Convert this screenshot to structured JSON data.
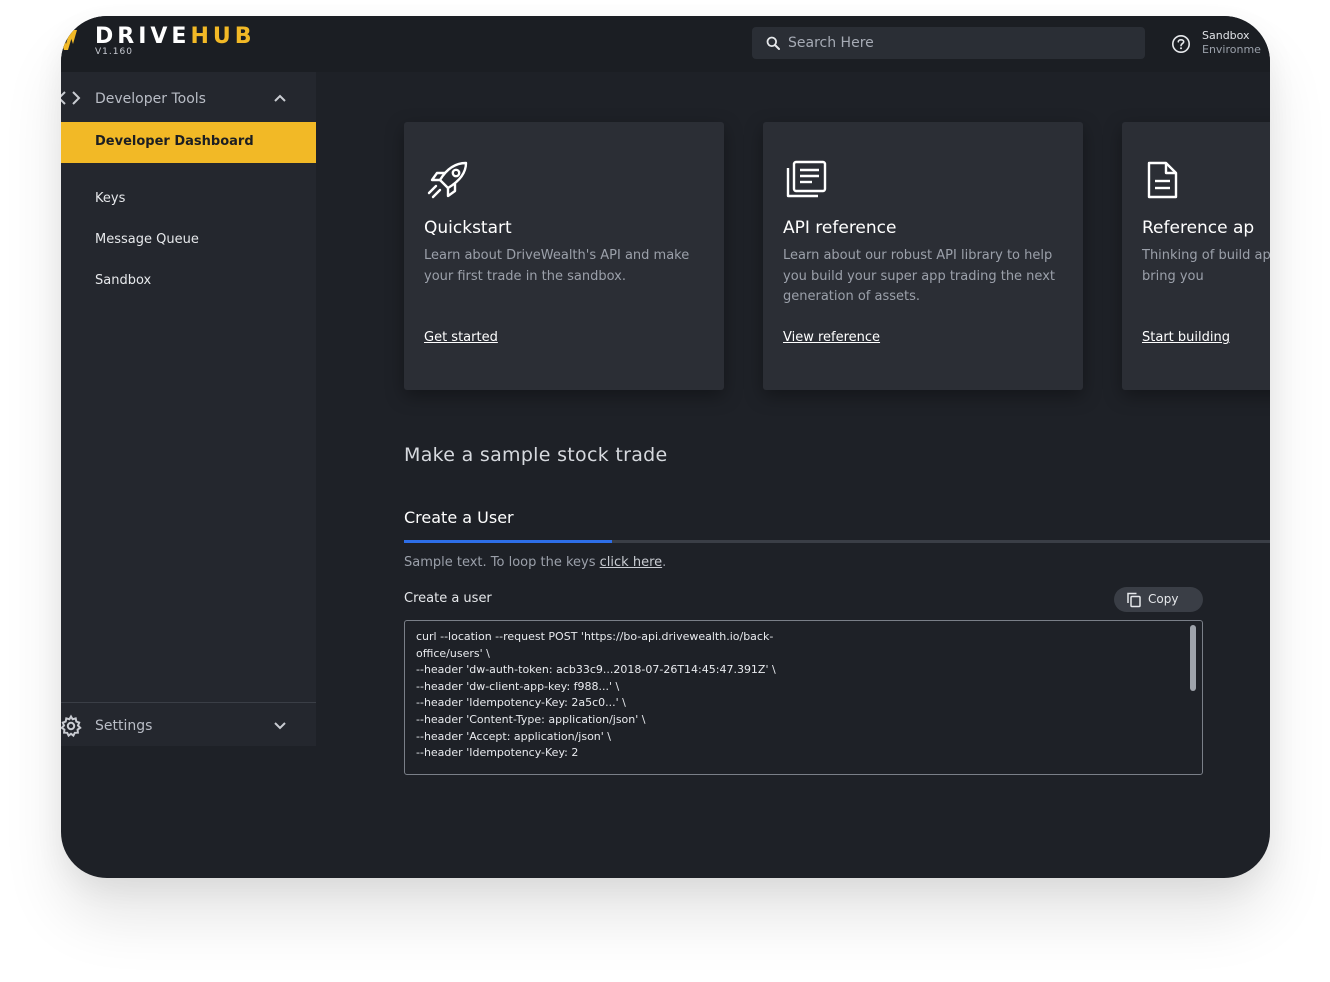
{
  "header": {
    "brand_left": "DRIVE",
    "brand_right": "HUB",
    "version": "V1.160",
    "search_placeholder": "Search Here",
    "environment_title": "Sandbox",
    "environment_subtitle": "Environme"
  },
  "sidebar": {
    "section_label": "Developer Tools",
    "items": [
      {
        "label": "Developer Dashboard",
        "active": true
      },
      {
        "label": "Keys"
      },
      {
        "label": "Message Queue"
      },
      {
        "label": "Sandbox"
      }
    ],
    "footer_label": "Settings"
  },
  "cards": [
    {
      "title": "Quickstart",
      "description": "Learn about DriveWealth's API and make your first trade in the sandbox.",
      "link": "Get started",
      "icon": "rocket-icon"
    },
    {
      "title": "API reference",
      "description": "Learn about our robust API library to help you build your super app trading the next generation of assets.",
      "link": "View reference",
      "icon": "document-list-icon"
    },
    {
      "title": "Reference ap",
      "description": "Thinking of build app? Start with o SDK to bring you",
      "link": "Start building",
      "icon": "file-icon"
    }
  ],
  "main": {
    "section_title": "Make a sample stock trade",
    "step_title": "Create a User",
    "step_progress": 0.24,
    "sample_text": "Sample text. To loop the keys ",
    "sample_link": "click here",
    "sample_suffix": ".",
    "code_label": "Create a user",
    "copy_label": "Copy",
    "code_lines": [
      "curl --location --request POST 'https://bo-api.drivewealth.io/back-",
      "office/users' \\",
      "--header 'dw-auth-token: acb33c9...2018-07-26T14:45:47.391Z' \\",
      "--header 'dw-client-app-key: f988...' \\",
      "--header 'Idempotency-Key: 2a5c0...' \\",
      "--header 'Content-Type: application/json' \\",
      "--header 'Accept: application/json' \\",
      "--header 'Idempotency-Key: 2"
    ]
  },
  "colors": {
    "accent": "#f2b926",
    "progress": "#2d6ee8",
    "background": "#1e2127"
  }
}
